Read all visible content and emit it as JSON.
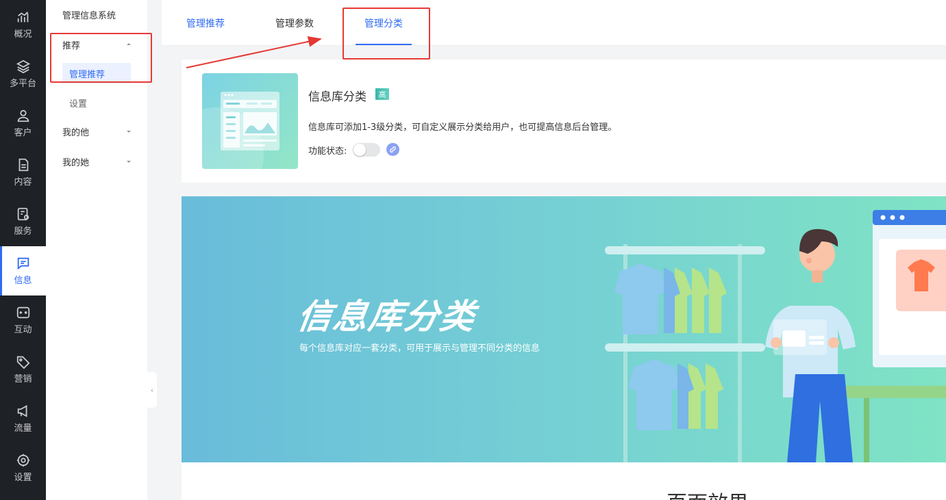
{
  "rail": {
    "items": [
      {
        "label": "概况",
        "icon": "chart-icon"
      },
      {
        "label": "多平台",
        "icon": "layers-icon"
      },
      {
        "label": "客户",
        "icon": "user-icon"
      },
      {
        "label": "内容",
        "icon": "document-icon"
      },
      {
        "label": "服务",
        "icon": "service-icon"
      },
      {
        "label": "信息",
        "icon": "message-icon"
      },
      {
        "label": "互动",
        "icon": "gamepad-icon"
      },
      {
        "label": "营销",
        "icon": "tag-icon"
      },
      {
        "label": "流量",
        "icon": "megaphone-icon"
      },
      {
        "label": "设置",
        "icon": "settings-icon"
      }
    ],
    "active_label": "信息"
  },
  "menu": {
    "title": "管理信息系统",
    "groups": [
      {
        "label": "推荐",
        "expanded": true
      },
      {
        "label": "我的他",
        "expanded": false
      },
      {
        "label": "我的她",
        "expanded": false
      }
    ],
    "sub_items": [
      {
        "label": "管理推荐",
        "active": true
      },
      {
        "label": "设置",
        "active": false
      }
    ]
  },
  "tabs": [
    {
      "label": "管理推荐"
    },
    {
      "label": "管理参数"
    },
    {
      "label": "管理分类",
      "active": true
    }
  ],
  "feature": {
    "title": "信息库分类",
    "badge": "高",
    "description": "信息库可添加1-3级分类，可自定义展示分类给用户，也可提高信息后台管理。",
    "status_label": "功能状态:",
    "status_on": false
  },
  "banner": {
    "title": "信息库分类",
    "subtitle": "每个信息库对应一套分类，可用于展示与管理不同分类的信息"
  },
  "bottom": {
    "peek_text": "页面效果"
  },
  "colors": {
    "primary": "#2f6bf4",
    "rail_bg": "#1e2126",
    "annotation": "#e53935"
  }
}
